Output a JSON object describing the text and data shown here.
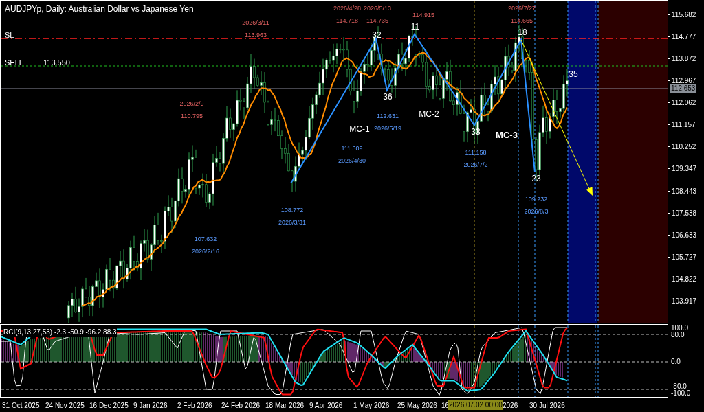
{
  "chart_title": "AUDJPYp, Daily:  Australian Dollar vs Japanese Yen",
  "price_lines": [
    {
      "kind": "sl",
      "label": "SL"
    },
    {
      "kind": "sell",
      "label": "SELL",
      "price": "113.550"
    }
  ],
  "swing_labels": [
    {
      "kind": "high",
      "date": "2026/4/28",
      "price": "114.718"
    },
    {
      "kind": "high",
      "date": "2026/5/13",
      "price": "114.735"
    },
    {
      "kind": "high",
      "price": "114.915"
    },
    {
      "kind": "high",
      "date": "2026/7/27",
      "price": "114.665"
    },
    {
      "kind": "high",
      "date": "2026/3/11",
      "price": "113.963"
    },
    {
      "kind": "high",
      "date": "2026/2/9",
      "price": "110.795"
    },
    {
      "kind": "low",
      "price": "112.631",
      "date": "2026/5/19"
    },
    {
      "kind": "low",
      "price": "111.309",
      "date": "2026/4/30"
    },
    {
      "kind": "low",
      "price": "111.158",
      "date": "2026/7/2"
    },
    {
      "kind": "low",
      "price": "109.232",
      "date": "2026/8/3"
    },
    {
      "kind": "low",
      "price": "108.772",
      "date": "2026/3/31"
    },
    {
      "kind": "low",
      "price": "107.632",
      "date": "2026/2/16"
    }
  ],
  "wave_labels": [
    {
      "text": "32"
    },
    {
      "text": "11"
    },
    {
      "text": "18"
    },
    {
      "text": "35"
    },
    {
      "text": "36"
    },
    {
      "text": "33"
    },
    {
      "text": "23"
    }
  ],
  "pattern_labels": [
    {
      "text": "MC-1",
      "emphasized": false
    },
    {
      "text": "MC-2",
      "emphasized": false
    },
    {
      "text": "MC-3",
      "emphasized": true
    }
  ],
  "price_axis": {
    "ticks": [
      "115.682",
      "114.777",
      "113.872",
      "112.967",
      "112.062",
      "111.157",
      "110.252",
      "109.347",
      "108.443",
      "107.538",
      "106.633",
      "105.727",
      "104.822",
      "103.917"
    ],
    "current_price": "112.653"
  },
  "indicator": {
    "label": "RCI(9,13,27,53) -2.3 -50.9 -96.2 88.3",
    "axis_labels": [
      "100.0",
      "80.0",
      "0.0",
      "-80.0",
      "-100.0"
    ]
  },
  "time_axis": {
    "labels": [
      "31 Oct 2025",
      "24 Nov 2025",
      "16 Dec 2025",
      "9 Jan 2026",
      "2 Feb 2026",
      "24 Feb 2026",
      "18 Mar 2026",
      "9 Apr 2026",
      "1 May 2026",
      "25 May 2026",
      "16",
      "2026",
      "30 Jul 2026"
    ],
    "crosshair_label": "2026.07.02 00:00"
  }
}
